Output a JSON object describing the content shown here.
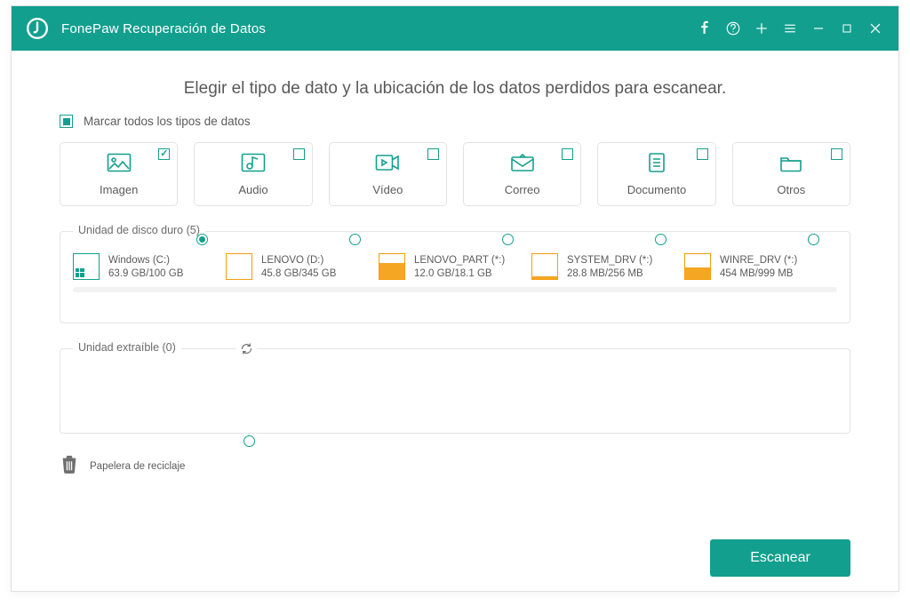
{
  "app": {
    "title": "FonePaw Recuperación de Datos"
  },
  "main": {
    "headline": "Elegir el tipo de dato y la ubicación de los datos perdidos para escanear.",
    "check_all_label": "Marcar todos los tipos de datos",
    "types": {
      "image": "Imagen",
      "audio": "Audio",
      "video": "Vídeo",
      "mail": "Correo",
      "doc": "Documento",
      "other": "Otros"
    },
    "hdd_legend": "Unidad de disco duro (5)",
    "drives": [
      {
        "name": "Windows (C:)",
        "size": "63.9 GB/100 GB",
        "fill_pct": 0,
        "system": true
      },
      {
        "name": "LENOVO (D:)",
        "size": "45.8 GB/345 GB",
        "fill_pct": 0
      },
      {
        "name": "LENOVO_PART (*:)",
        "size": "12.0 GB/18.1 GB",
        "fill_pct": 66
      },
      {
        "name": "SYSTEM_DRV (*:)",
        "size": "28.8 MB/256 MB",
        "fill_pct": 11
      },
      {
        "name": "WINRE_DRV (*:)",
        "size": "454 MB/999 MB",
        "fill_pct": 45
      }
    ],
    "removable_legend": "Unidad extraíble (0)",
    "recycle_label": "Papelera de reciclaje",
    "scan_label": "Escanear"
  }
}
